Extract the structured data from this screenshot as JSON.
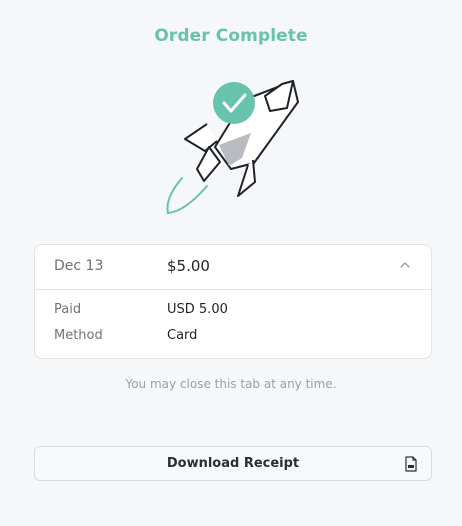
{
  "header": {
    "title": "Order Complete"
  },
  "illustration": {
    "icon": "rocket-icon",
    "badge_icon": "check-icon",
    "accent": "#67c3ac"
  },
  "summary": {
    "date": "Dec 13",
    "amount": "$5.00",
    "toggle_icon": "chevron-up-icon",
    "rows": [
      {
        "label": "Paid",
        "value": "USD 5.00"
      },
      {
        "label": "Method",
        "value": "Card"
      }
    ]
  },
  "note": "You may close this tab at any time.",
  "download": {
    "label": "Download Receipt",
    "icon": "pdf-file-icon"
  }
}
